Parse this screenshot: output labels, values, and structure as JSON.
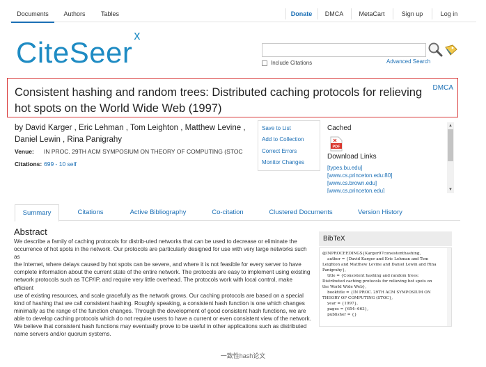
{
  "nav": {
    "left": [
      "Documents",
      "Authors",
      "Tables"
    ],
    "right": [
      "Donate",
      "DMCA",
      "MetaCart",
      "Sign up",
      "Log in"
    ]
  },
  "logo": {
    "text": "CiteSeer",
    "sup": "x"
  },
  "search": {
    "value": "",
    "include_citations": "Include Citations",
    "advanced": "Advanced Search"
  },
  "paper": {
    "title": "Consistent hashing and random trees: Distributed caching protocols for relieving hot spots on the World Wide Web (1997)",
    "dmca": "DMCA",
    "authors_line1": "by David Karger , Eric Lehman , Tom Leighton , Matthew Levine ,",
    "authors_line2": "Daniel Lewin , Rina Panigrahy",
    "venue_label": "Venue:",
    "venue": "IN PROC. 29TH ACM SYMPOSIUM ON THEORY OF COMPUTING (STOC",
    "citations_label": "Citations:",
    "citations": "699 - 10 self"
  },
  "actions": [
    "Save to List",
    "Add to Collection",
    "Correct Errors",
    "Monitor Changes"
  ],
  "downloads": {
    "cached": "Cached",
    "title": "Download Links",
    "links": [
      "[types.bu.edu]",
      "[www.cs.princeton.edu:80]",
      "[www.cs.brown.edu]",
      "[www.cs.princeton.edu]"
    ]
  },
  "tabs": [
    "Summary",
    "Citations",
    "Active Bibliography",
    "Co-citation",
    "Clustered Documents",
    "Version History"
  ],
  "abstract": {
    "heading": "Abstract",
    "lines": [
      "We describe a family of caching protocols for distrib-uted networks that can be used to decrease or eliminate the",
      "occurrence of hot spots in the network. Our protocols are particularly designed for use with very large networks such as",
      "the Internet, where delays caused by hot spots can be severe, and where it is not feasible for every server to have",
      "complete information about the current state of the entire network. The protocols are easy to implement using existing",
      "network protocols such as TCP/IP, and require very little overhead. The protocols work with local control, make efficient",
      "use of existing resources, and scale gracefully as the network grows. Our caching protocols are based on a special",
      "kind of hashing that we call consistent hashing. Roughly speaking, a consistent hash function is one which changes",
      "minimally as the range of the function changes. Through the development of good consistent hash functions, we are",
      "able to develop caching protocols which do not require users to have a current or even consistent view of the network.",
      "We believe that consistent hash functions may eventually prove to be useful in other applications such as distributed",
      "name servers and/or quorum systems."
    ]
  },
  "bibtex": {
    "heading": "BibTeX",
    "text": "@INPROCEEDINGS{Karger97consistenthashing,\n    author = {David Karger and Eric Lehman and Tom\nLeighton and Matthew Levine and Daniel Lewin and Rina\nPanigrahy},\n    title = {Consistent hashing and random trees:\nDistributed caching protocols for relieving hot spots on\nthe World Wide Web},\n    booktitle = {IN PROC. 29TH ACM SYMPOSIUM ON\nTHEORY OF COMPUTING (STOC},\n    year = {1997},\n    pages = {654--663},\n    publisher = {}"
  },
  "caption": "一致性hash论文",
  "colors": {
    "accent": "#1b6fb5",
    "logo": "#1e8bc3",
    "title_border": "#d93b3b"
  }
}
